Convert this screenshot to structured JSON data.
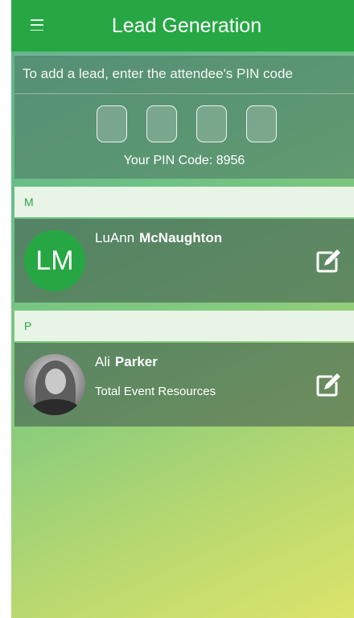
{
  "header": {
    "title": "Lead Generation",
    "menu_icon": "hamburger-menu-icon",
    "color": "#27a744"
  },
  "pin_entry": {
    "instruction": "To add a lead, enter the attendee's PIN code",
    "digit_count": 4,
    "your_pin_label": "Your PIN Code: 8956"
  },
  "sections": [
    {
      "letter": "M",
      "contacts": [
        {
          "first_name": "LuAnn",
          "last_name": "McNaughton",
          "organization": "",
          "avatar": "initials",
          "initials": "LM"
        }
      ]
    },
    {
      "letter": "P",
      "contacts": [
        {
          "first_name": "Ali",
          "last_name": "Parker",
          "organization": "Total Event Resources",
          "avatar": "photo",
          "initials": ""
        }
      ]
    }
  ],
  "icons": {
    "edit": "edit-pencil-icon"
  },
  "colors": {
    "accent": "#27a744",
    "section_bg": "#e8f4e6"
  }
}
